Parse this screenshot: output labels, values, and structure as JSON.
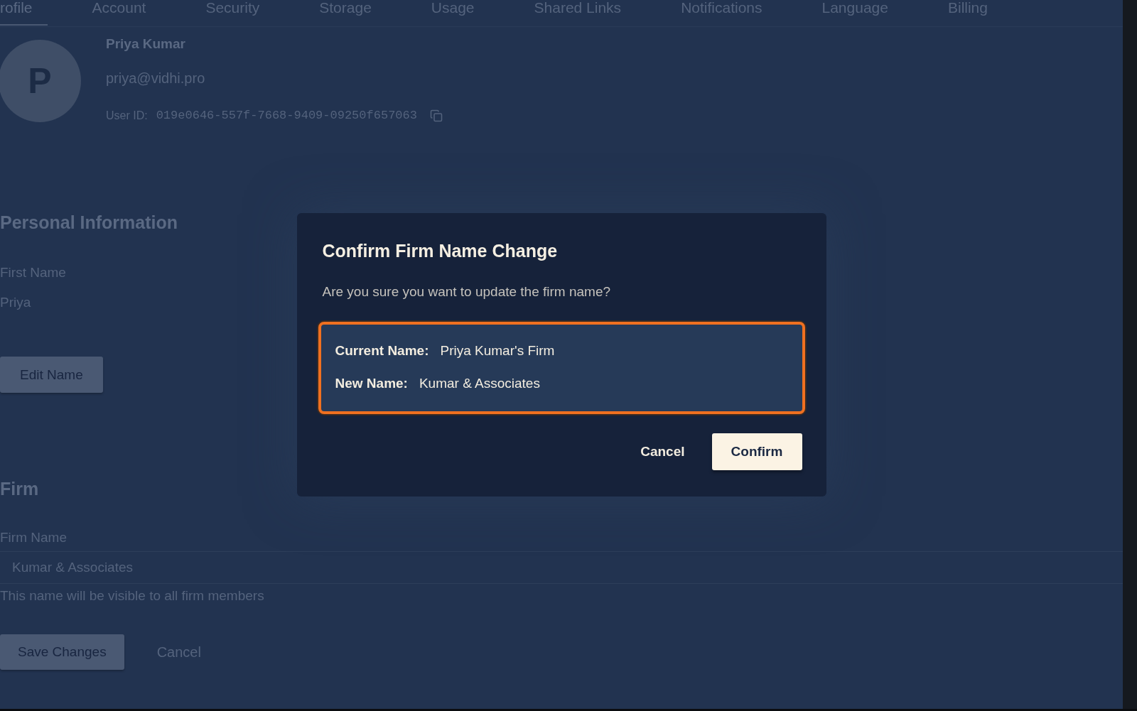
{
  "tabs": [
    {
      "label": "rofile",
      "selected": true
    },
    {
      "label": "Account",
      "selected": false
    },
    {
      "label": "Security",
      "selected": false
    },
    {
      "label": "Storage",
      "selected": false
    },
    {
      "label": "Usage",
      "selected": false
    },
    {
      "label": "Shared Links",
      "selected": false
    },
    {
      "label": "Notifications",
      "selected": false
    },
    {
      "label": "Language",
      "selected": false
    },
    {
      "label": "Billing",
      "selected": false
    }
  ],
  "profile": {
    "avatar_initial": "P",
    "name": "Priya Kumar",
    "email": "priya@vidhi.pro",
    "user_id_label": "User ID:",
    "user_id": "019e0646-557f-7668-9409-09250f657063"
  },
  "personal_information": {
    "heading": "Personal Information",
    "first_name_label": "First Name",
    "first_name": "Priya",
    "edit_button": "Edit Name"
  },
  "firm": {
    "heading": "Firm",
    "firm_name_label": "Firm Name",
    "firm_name": "Kumar & Associates",
    "helper": "This name will be visible to all firm members"
  },
  "actions": [
    {
      "label": "Save Changes",
      "kind": "primary"
    },
    {
      "label": "Cancel",
      "kind": "text"
    }
  ],
  "dialog": {
    "title": "Confirm Firm Name Change",
    "message": "Are you sure you want to update the firm name?",
    "rows": [
      {
        "label": "Current Name:",
        "value": "Priya Kumar's Firm"
      },
      {
        "label": "New Name:",
        "value": "Kumar & Associates"
      }
    ],
    "buttons": [
      {
        "label": "Cancel",
        "kind": "text"
      },
      {
        "label": "Confirm",
        "kind": "primary"
      }
    ]
  }
}
